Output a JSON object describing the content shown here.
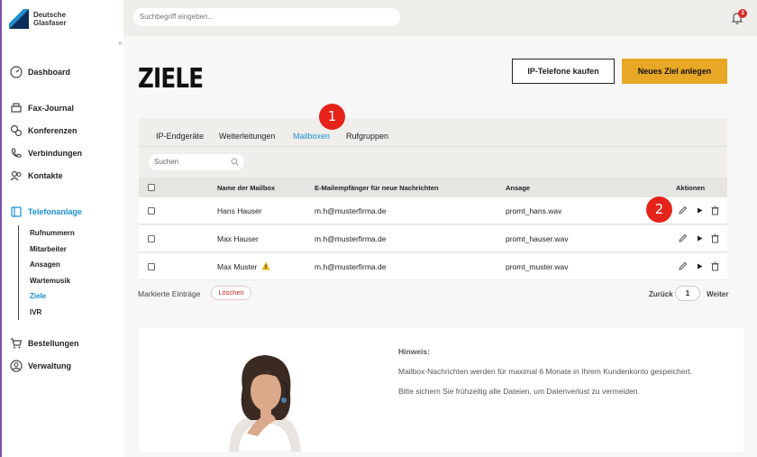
{
  "brand": {
    "line1": "Deutsche",
    "line2": "Glasfaser"
  },
  "search": {
    "placeholder": "Suchbegriff eingeben..."
  },
  "notifications": {
    "count": "3"
  },
  "nav": {
    "dashboard": "Dashboard",
    "fax": "Fax-Journal",
    "konferenzen": "Konferenzen",
    "verbindungen": "Verbindungen",
    "kontakte": "Kontakte",
    "telefonanlage": "Telefonanlage",
    "sub": [
      "Rufnummern",
      "Mitarbeiter",
      "Ansagen",
      "Wartemusik",
      "Ziele",
      "IVR"
    ],
    "bestellungen": "Bestellungen",
    "verwaltung": "Verwaltung"
  },
  "page": {
    "title": "ZIELE",
    "btn_buy": "IP-Telefone kaufen",
    "btn_new": "Neues Ziel anlegen"
  },
  "tabs": [
    "IP-Endgeräte",
    "Weiterleitungen",
    "Mailboxen",
    "Rufgruppen"
  ],
  "table": {
    "search_placeholder": "Suchen",
    "headers": {
      "name": "Name der Mailbox",
      "email": "E-Mailempfänger für neue Nachrichten",
      "ansage": "Ansage",
      "aktionen": "Aktionen"
    },
    "rows": [
      {
        "name": "Hans Hauser",
        "email": "m.h@musterfirma.de",
        "ansage": "promt_hans.wav"
      },
      {
        "name": "Max Hauser",
        "email": "m.h@musterfirma.de",
        "ansage": "promt_hauser.wav"
      },
      {
        "name": "Max Muster",
        "email": "m.h@musterfirma.de",
        "ansage": "promt_muster.wav"
      }
    ],
    "marked": "Markierte Einträge",
    "delete": "Löschen",
    "prev": "Zurück",
    "page": "1",
    "next": "Weiter"
  },
  "markers": [
    "1",
    "2"
  ],
  "hint": {
    "title": "Hinweis:",
    "line1": "Mailbox-Nachrichten werden für maximal 6 Monate in Ihrem Kundenkonto gespeichert.",
    "line2": "Bitte sichern Sie frühzeitig alle Dateien, um Datenverlust zu vermeiden."
  },
  "colors": {
    "accent": "#1a8fd1",
    "primary_button": "#e8a825",
    "marker": "#e5231b",
    "sidebar_border": "#7a50a8"
  }
}
